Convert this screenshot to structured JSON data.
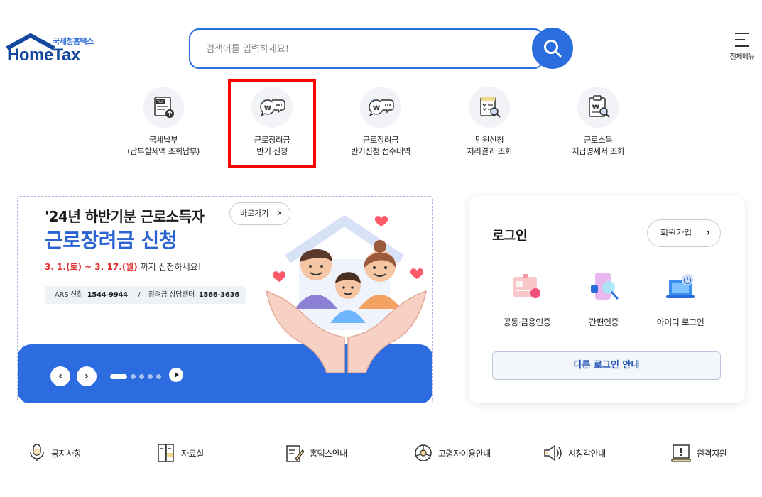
{
  "header": {
    "logo_sub": "국세청홈택스",
    "logo_main": "HomeTax",
    "search_placeholder": "검색어를 입력하세요!",
    "menu_label": "전체메뉴"
  },
  "quick_menu": [
    {
      "line1": "국세납부",
      "line2": "(납부할세액 조회납부)",
      "icon": "tax-payment-icon"
    },
    {
      "line1": "근로장려금",
      "line2": "반기 신청",
      "icon": "earned-income-incentive-icon"
    },
    {
      "line1": "근로장려금",
      "line2": "반기신청 접수내역",
      "icon": "application-history-icon"
    },
    {
      "line1": "민원신청",
      "line2": "처리결과 조회",
      "icon": "civil-petition-icon"
    },
    {
      "line1": "근로소득",
      "line2": "지급명세서 조회",
      "icon": "payment-statement-icon"
    }
  ],
  "banner": {
    "title1": "'24년 하반기분 근로소득자",
    "title2": "근로장려금 신청",
    "go_label": "바로가기",
    "date_range": "3. 1.(토) ~ 3. 17.(월)",
    "date_suffix": " 까지 신청하세요!",
    "ars_label": "ARS 신청",
    "ars_number": "1544-9944",
    "sep": "/",
    "center_label": "장려금 상담센터",
    "center_number": "1566-3636",
    "slide_count": 5,
    "active_slide": 1
  },
  "login": {
    "title": "로그인",
    "join_label": "회원가입",
    "options": [
      {
        "label": "공동·금융인증",
        "icon": "certificate-icon"
      },
      {
        "label": "간편인증",
        "icon": "simple-auth-icon"
      },
      {
        "label": "아이디 로그인",
        "icon": "id-login-icon"
      }
    ],
    "other_label": "다른 로그인 안내"
  },
  "bottom_nav": [
    {
      "label": "공지사항",
      "icon": "microphone-icon"
    },
    {
      "label": "자료실",
      "icon": "archive-icon"
    },
    {
      "label": "홈택스안내",
      "icon": "guide-icon"
    },
    {
      "label": "고령자이용안내",
      "icon": "senior-icon"
    },
    {
      "label": "시청각안내",
      "icon": "speaker-icon"
    },
    {
      "label": "원격지원",
      "icon": "remote-support-icon"
    }
  ],
  "colors": {
    "brand_blue": "#2a6ddf",
    "highlight_red": "#ff0000",
    "banner_blue": "#2d6be0"
  }
}
